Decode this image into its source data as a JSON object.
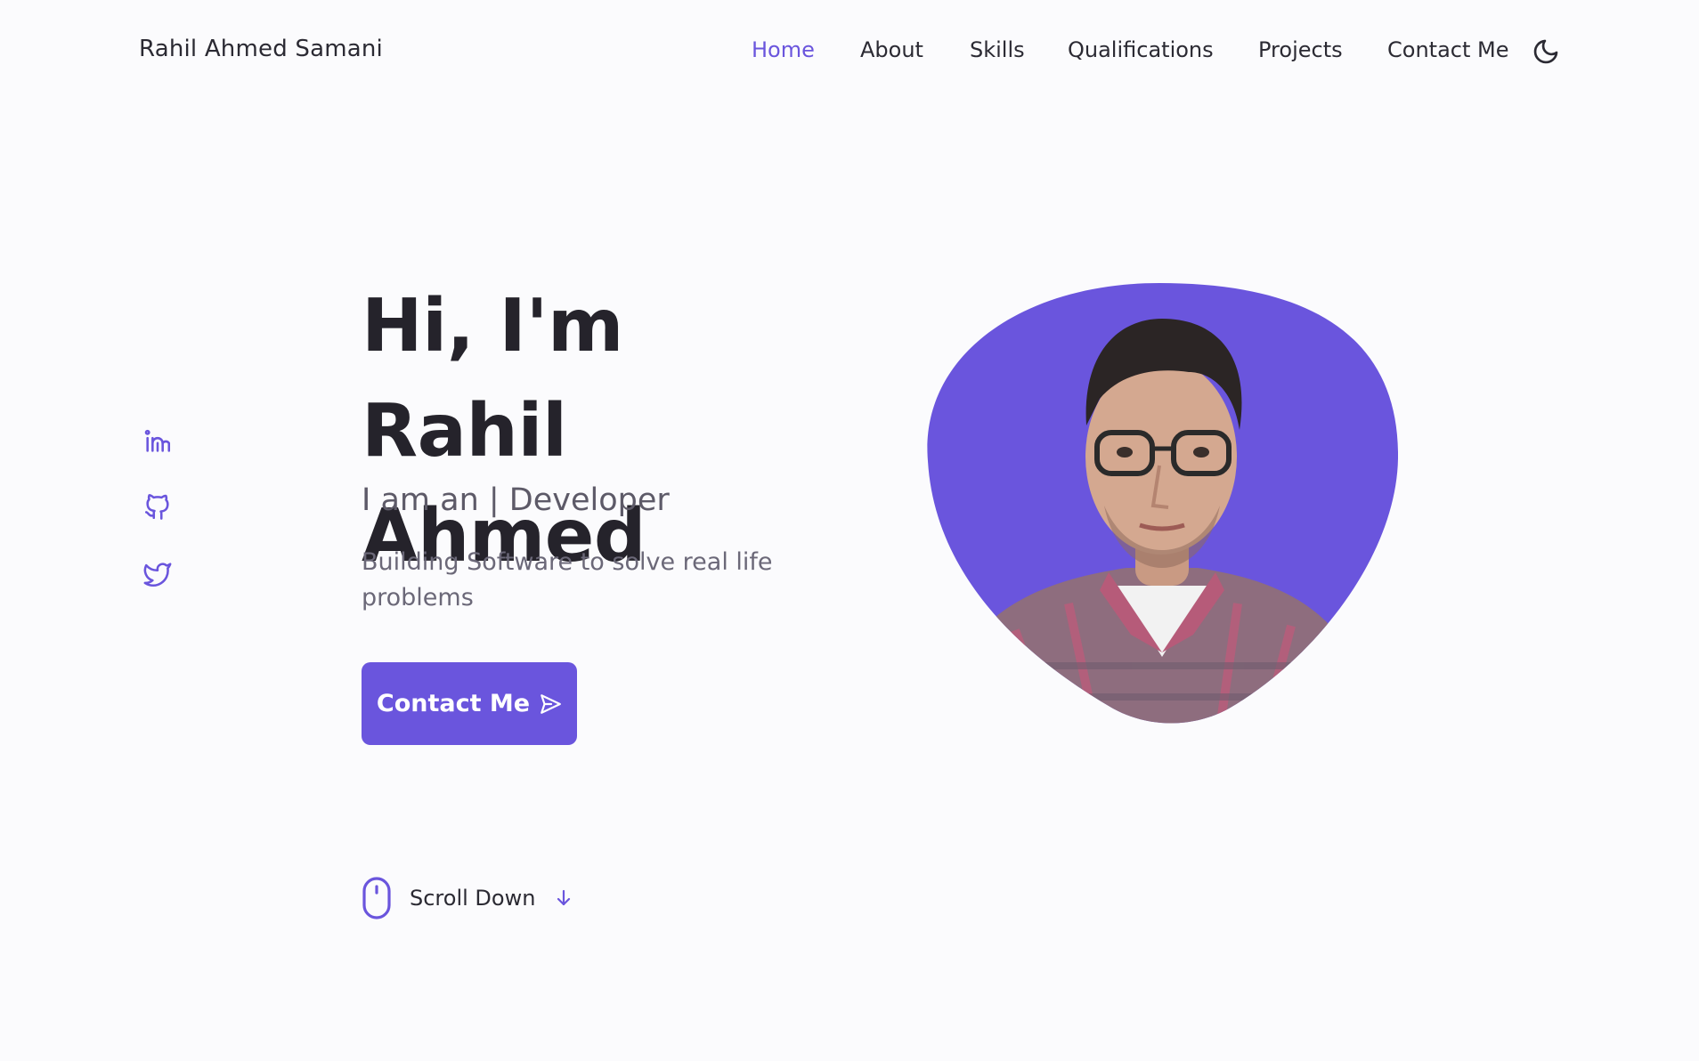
{
  "brand": "Rahil Ahmed Samani",
  "nav": {
    "items": [
      {
        "label": "Home",
        "active": true
      },
      {
        "label": "About",
        "active": false
      },
      {
        "label": "Skills",
        "active": false
      },
      {
        "label": "Qualifications",
        "active": false
      },
      {
        "label": "Projects",
        "active": false
      },
      {
        "label": "Contact Me",
        "active": false
      }
    ],
    "theme_icon": "moon-icon"
  },
  "social": {
    "items": [
      {
        "icon": "linkedin-icon"
      },
      {
        "icon": "github-icon"
      },
      {
        "icon": "twitter-icon"
      }
    ]
  },
  "hero": {
    "title_line1": "Hi, I'm Rahil",
    "title_line2": "Ahmed",
    "subtitle": "I am an | Developer",
    "description": "Building Software to solve real life problems",
    "cta_label": "Contact Me",
    "cta_icon": "send-icon"
  },
  "scroll": {
    "label": "Scroll Down",
    "mouse_icon": "mouse-icon",
    "arrow_icon": "arrow-down-icon"
  },
  "colors": {
    "accent": "#6a55dd",
    "background": "#fbfbfd",
    "title": "#25232b",
    "text": "#6b6878"
  }
}
